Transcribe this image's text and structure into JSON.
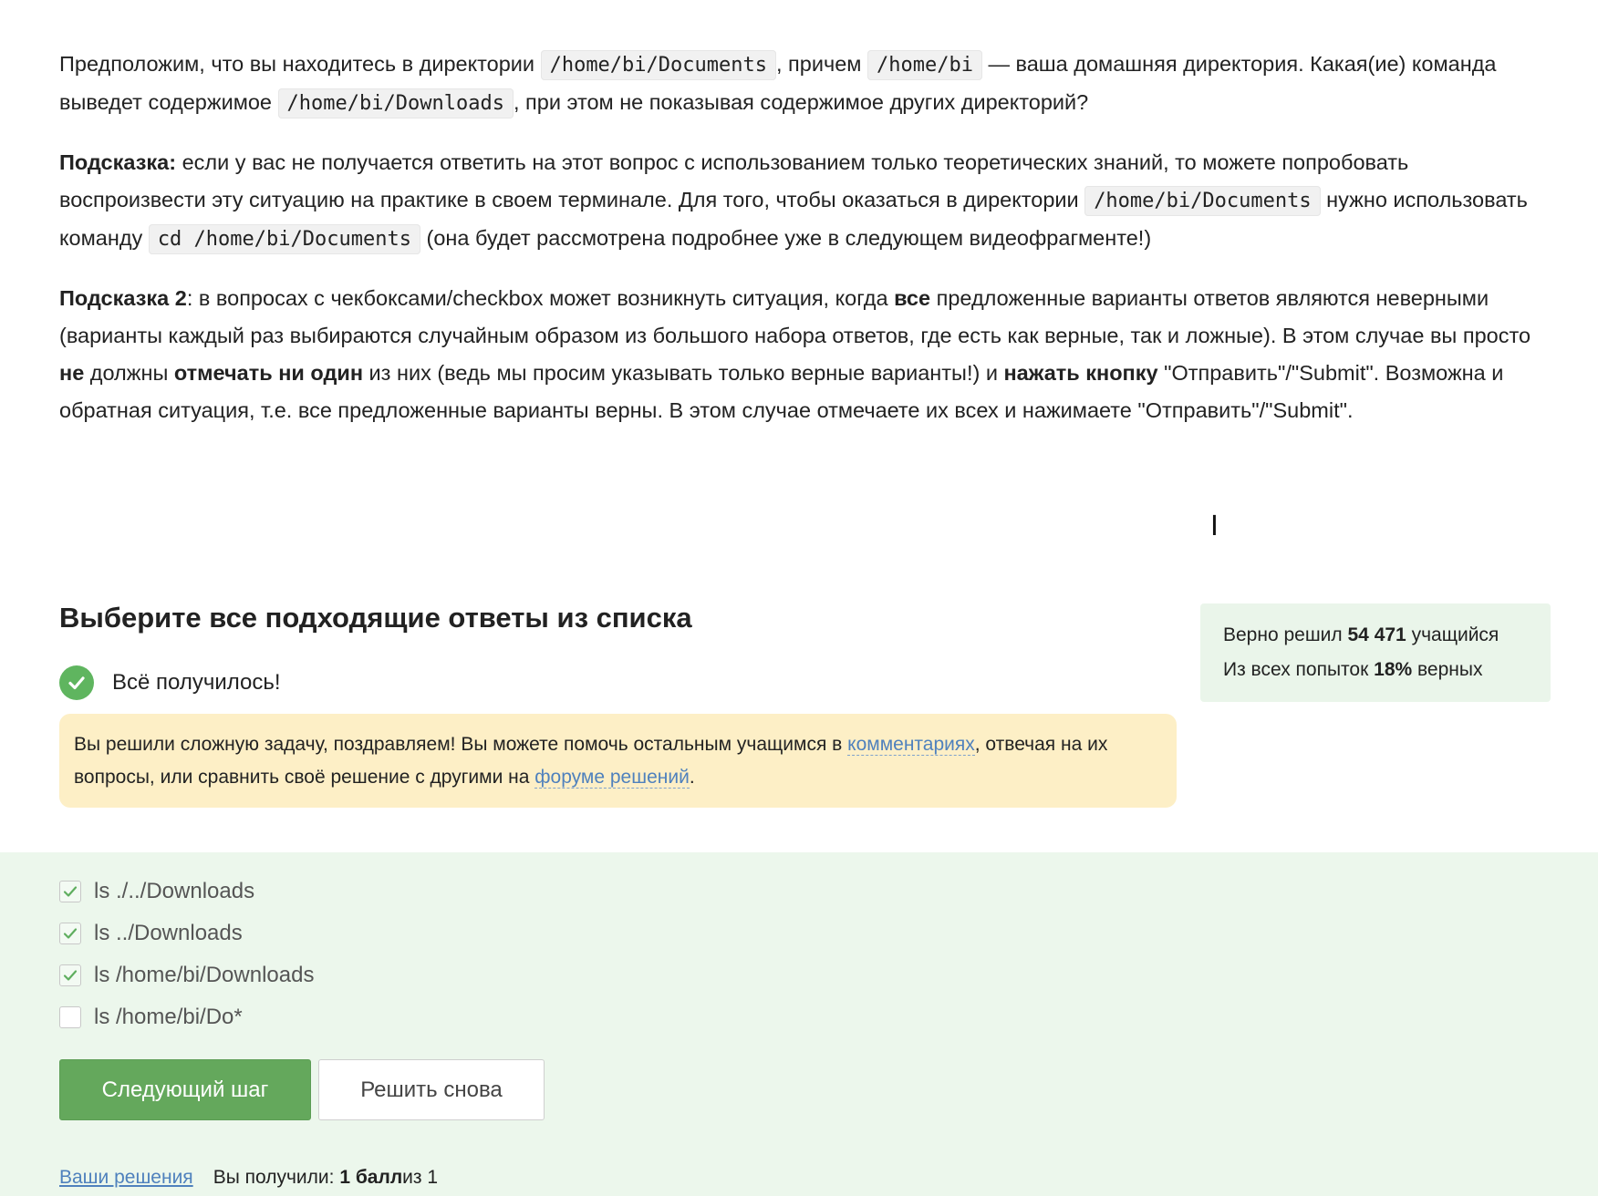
{
  "question": {
    "p1": {
      "t1": "Предположим, что вы находитесь в директории ",
      "c1": "/home/bi/Documents",
      "t2": ", причем ",
      "c2": "/home/bi",
      "t3": " — ваша домашняя директория. Какая(ие) команда выведет содержимое ",
      "c3": "/home/bi/Downloads",
      "t4": ", при этом не показывая содержимое других директорий?"
    },
    "p2": {
      "b1": "Подсказка:",
      "t1": " если у вас не получается ответить на этот вопрос с использованием только теоретических знаний, то можете попробовать воспроизвести эту ситуацию на практике в своем терминале. Для того, чтобы оказаться в директории ",
      "c1": "/home/bi/Documents",
      "t2": " нужно использовать команду ",
      "c2": "cd /home/bi/Documents",
      "t3": " (она будет рассмотрена подробнее уже в следующем видеофрагменте!)"
    },
    "p3": {
      "b1": "Подсказка 2",
      "t1": ": в вопросах с чекбоксами/checkbox может возникнуть ситуация, когда ",
      "b2": "все",
      "t2": " предложенные варианты ответов являются неверными (варианты каждый раз выбираются случайным образом из большого набора ответов, где есть как верные, так и ложные). В этом случае вы просто ",
      "b3": "не",
      "t3": " должны ",
      "b4": "отмечать ни один",
      "t4": " из них (ведь мы просим указывать только верные варианты!) и ",
      "b5": "нажать кнопку",
      "t5": " \"Отправить\"/\"Submit\". Возможна и обратная ситуация, т.е. все предложенные варианты верны. В этом случае отмечаете их всех и нажимаете \"Отправить\"/\"Submit\"."
    }
  },
  "quiz": {
    "title": "Выберите все подходящие ответы из списка",
    "status": "Всё получилось!",
    "feedback": {
      "t1": "Вы решили сложную задачу, поздравляем! Вы можете помочь остальным учащимся в ",
      "link1": "комментариях",
      "t2": ", отвечая на их вопросы, или сравнить своё решение с другими на ",
      "link2": "форуме решений",
      "t3": "."
    },
    "stats": {
      "line1_prefix": "Верно решил ",
      "line1_count": "54 471",
      "line1_suffix": " учащийся",
      "line2_prefix": "Из всех попыток ",
      "line2_percent": "18%",
      "line2_suffix": " верных"
    },
    "options": [
      {
        "label": "ls ./../Downloads",
        "checked": true
      },
      {
        "label": "ls ../Downloads",
        "checked": true
      },
      {
        "label": "ls /home/bi/Downloads",
        "checked": true
      },
      {
        "label": "ls /home/bi/Do*",
        "checked": false
      }
    ],
    "next_button": "Следующий шаг",
    "retry_button": "Решить снова",
    "footer": {
      "solutions_link": "Ваши решения",
      "score_prefix": "Вы получили: ",
      "score_value": "1 балл",
      "score_suffix": " из 1"
    }
  },
  "colors": {
    "accent_green": "#64a85c",
    "answers_bg": "#ecf7ec",
    "feedback_bg": "#fdefc6",
    "link": "#4f81bd"
  }
}
